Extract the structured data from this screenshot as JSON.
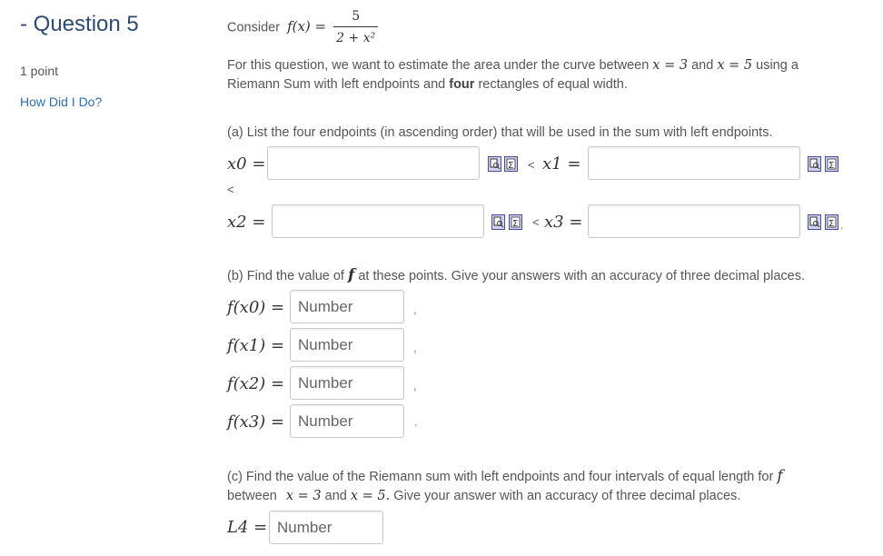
{
  "question": {
    "title": "- Question 5",
    "points": "1 point",
    "how_did_i_do": "How Did I Do?"
  },
  "intro": {
    "consider": "Consider",
    "fx_lhs": "f(x) =",
    "fx_num": "5",
    "fx_den": "2 + x²"
  },
  "description": {
    "line1_a": "For this question, we want to estimate the area under the curve between ",
    "x_eq_3": "x = 3",
    "and": " and ",
    "x_eq_5": "x = 5",
    "line1_b": " using a",
    "line2_a": "Riemann Sum with left endpoints and ",
    "four": "four",
    "line2_b": " rectangles of equal width."
  },
  "part_a": {
    "prompt": "(a) List the four endpoints (in ascending order) that will be used in the sum with left endpoints.",
    "labels": [
      "x0 =",
      "x1 =",
      "x2 =",
      "x3 ="
    ],
    "less_than": "<",
    "values": [
      "",
      "",
      "",
      ""
    ]
  },
  "part_b": {
    "prompt_a": "(b) Find the value of ",
    "f": "f",
    "prompt_b": " at these points. Give your answers with an accuracy of three decimal places.",
    "labels": [
      "f(x0) =",
      "f(x1) =",
      "f(x2) =",
      "f(x3) ="
    ],
    "placeholder": "Number",
    "values": [
      "",
      "",
      "",
      ""
    ],
    "separators": [
      ",",
      ",",
      ",",
      "."
    ]
  },
  "part_c": {
    "line1": "(c) Find the value of the Riemann sum with left endpoints and four intervals of equal length for ",
    "f": "f",
    "line2_a": "between ",
    "x_eq_3": "x = 3",
    "and": " and ",
    "x_eq_5": "x = 5.",
    "line2_b": " Give your answer with an accuracy of three decimal places.",
    "label": "L4 =",
    "placeholder": "Number",
    "value": ""
  },
  "icons": {
    "preview": "preview-icon",
    "sigma": "sigma-icon"
  },
  "colors": {
    "title": "#2d4a73",
    "link": "#2a6ebb",
    "icon_fill": "#cfd3f5"
  }
}
